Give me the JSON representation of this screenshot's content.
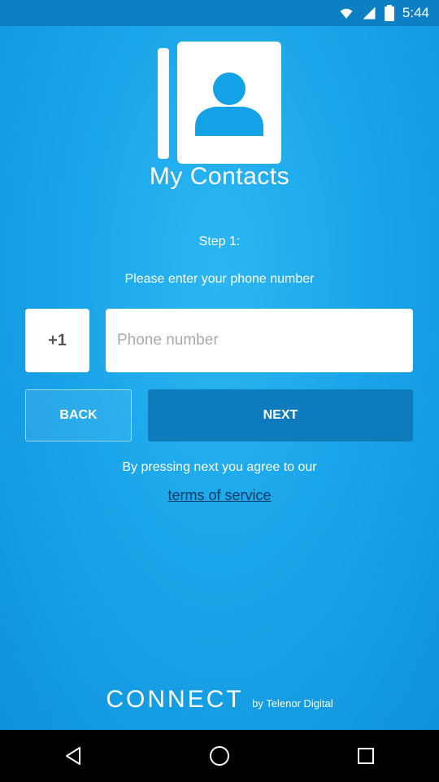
{
  "status_bar": {
    "time": "5:44"
  },
  "app": {
    "title": "My Contacts"
  },
  "step": {
    "label": "Step 1:",
    "prompt": "Please enter your phone number"
  },
  "phone": {
    "country_code": "+1",
    "placeholder": "Phone number",
    "value": ""
  },
  "buttons": {
    "back": "BACK",
    "next": "NEXT"
  },
  "agreement": {
    "text": "By pressing next you agree to our",
    "link": "terms of service"
  },
  "branding": {
    "name": "CONNECT",
    "byline": "by Telenor Digital"
  },
  "nav": {
    "icons": [
      "back-icon",
      "home-icon",
      "recents-icon"
    ]
  },
  "colors": {
    "background": "#14a2e6",
    "next_button": "#0e7bbd",
    "link": "#083d66"
  }
}
